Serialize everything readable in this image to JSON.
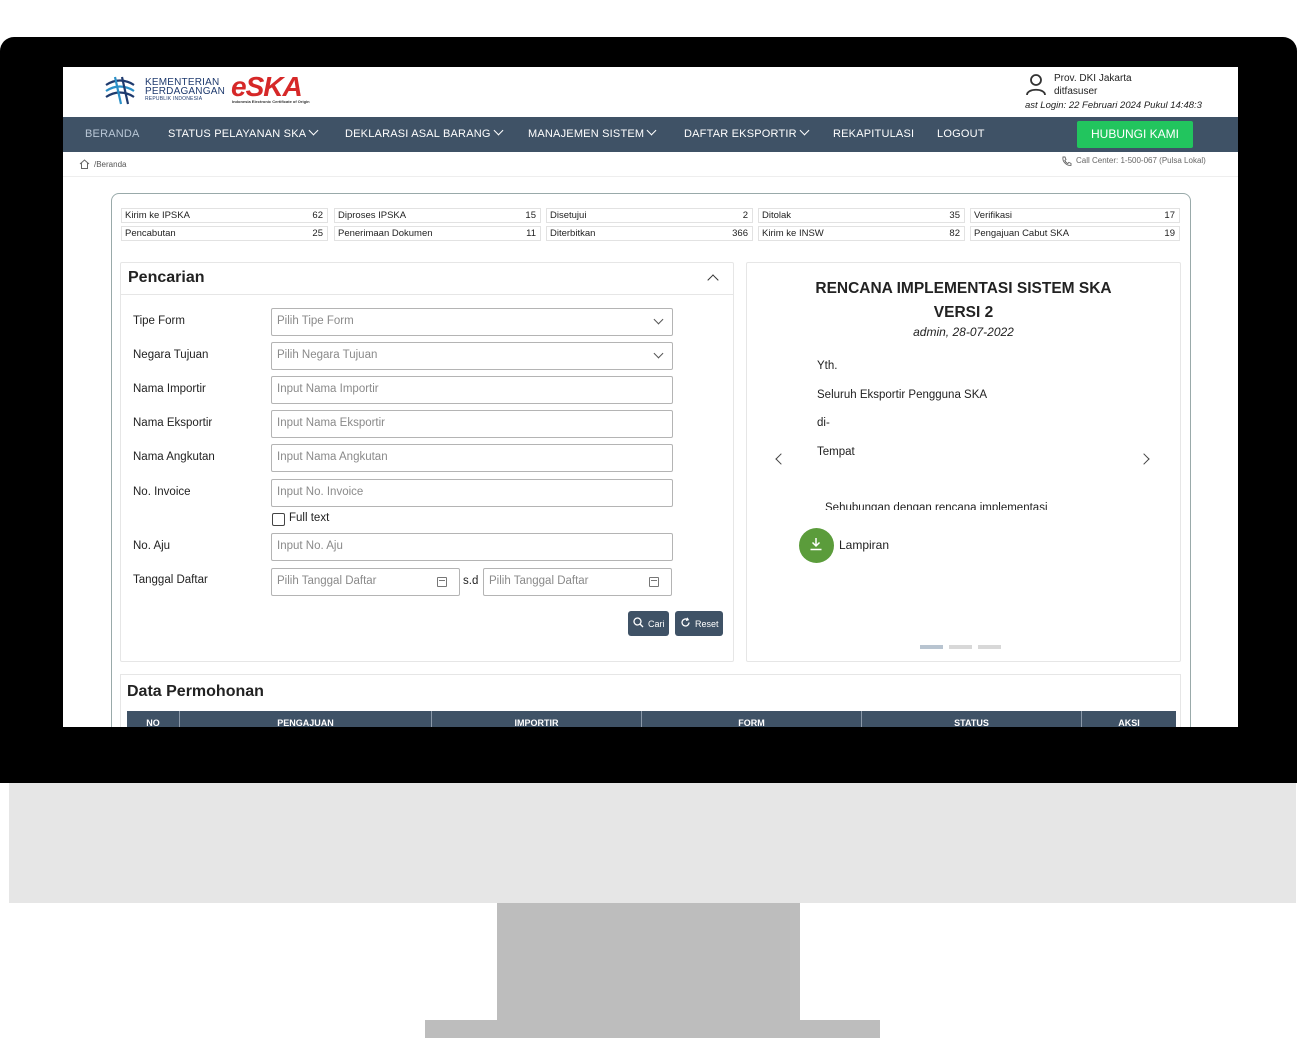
{
  "logo": {
    "line1": "KEMENTERIAN",
    "line2": "PERDAGANGAN",
    "line3": "REPUBLIK INDONESIA",
    "brand": "eSKA",
    "brand_sub": "Indonesia Electronic Certificate of Origin"
  },
  "user": {
    "icon": "user-icon",
    "province": "Prov. DKI Jakarta",
    "username": "ditfasuser",
    "last_login": "ast Login: 22 Februari 2024 Pukul 14:48:3"
  },
  "nav": {
    "items": [
      {
        "label": "BERANDA",
        "dropdown": false,
        "active": true
      },
      {
        "label": "STATUS PELAYANAN SKA",
        "dropdown": true
      },
      {
        "label": "DEKLARASI ASAL BARANG",
        "dropdown": true
      },
      {
        "label": "MANAJEMEN SISTEM",
        "dropdown": true
      },
      {
        "label": "DAFTAR EKSPORTIR",
        "dropdown": true
      },
      {
        "label": "REKAPITULASI",
        "dropdown": false
      },
      {
        "label": "LOGOUT",
        "dropdown": false
      }
    ],
    "contact_button": "HUBUNGI KAMI",
    "contact_color": "#22c55e",
    "bar_color": "#3f5266"
  },
  "breadcrumb": {
    "icon": "home-icon",
    "path": "/Beranda"
  },
  "call_center": {
    "icon": "phone-icon",
    "text": "Call Center: 1-500-067 (Pulsa Lokal)"
  },
  "stats": [
    {
      "label": "Kirim ke IPSKA",
      "value": "62"
    },
    {
      "label": "Diproses IPSKA",
      "value": "15"
    },
    {
      "label": "Disetujui",
      "value": "2"
    },
    {
      "label": "Ditolak",
      "value": "35"
    },
    {
      "label": "Verifikasi",
      "value": "17"
    },
    {
      "label": "Pencabutan",
      "value": "25"
    },
    {
      "label": "Penerimaan Dokumen",
      "value": "11"
    },
    {
      "label": "Diterbitkan",
      "value": "366"
    },
    {
      "label": "Kirim ke INSW",
      "value": "82"
    },
    {
      "label": "Pengajuan Cabut SKA",
      "value": "19"
    }
  ],
  "search": {
    "title": "Pencarian",
    "fields": {
      "tipe_form": {
        "label": "Tipe Form",
        "placeholder": "Pilih Tipe Form"
      },
      "negara_tujuan": {
        "label": "Negara Tujuan",
        "placeholder": "Pilih Negara Tujuan"
      },
      "nama_importir": {
        "label": "Nama Importir",
        "placeholder": "Input Nama Importir"
      },
      "nama_eksportir": {
        "label": "Nama Eksportir",
        "placeholder": "Input Nama Eksportir"
      },
      "nama_angkutan": {
        "label": "Nama Angkutan",
        "placeholder": "Input Nama Angkutan"
      },
      "no_invoice": {
        "label": "No. Invoice",
        "placeholder": "Input No. Invoice"
      },
      "full_text": {
        "label": "Full text"
      },
      "no_aju": {
        "label": "No. Aju",
        "placeholder": "Input No. Aju"
      },
      "tanggal_daftar": {
        "label": "Tanggal Daftar",
        "from_placeholder": "Pilih Tanggal Daftar",
        "separator": "s.d",
        "to_placeholder": "Pilih Tanggal Daftar"
      }
    },
    "buttons": {
      "search": "Cari",
      "reset": "Reset"
    }
  },
  "announcement": {
    "title_line1": "RENCANA IMPLEMENTASI SISTEM SKA",
    "title_line2": "VERSI 2",
    "meta": "admin, 28-07-2022",
    "body": [
      "Yth.",
      "Seluruh Eksportir Pengguna SKA",
      "di-",
      "Tempat"
    ],
    "clipped_line": "Sehubungan dengan rencana implementasi",
    "attachment_label": "Lampiran",
    "attachment_color": "#5b9c3b",
    "slides": 3,
    "active_slide": 1
  },
  "data_table": {
    "title": "Data Permohonan",
    "columns": [
      "NO",
      "PENGAJUAN",
      "IMPORTIR",
      "FORM",
      "STATUS",
      "AKSI"
    ]
  }
}
